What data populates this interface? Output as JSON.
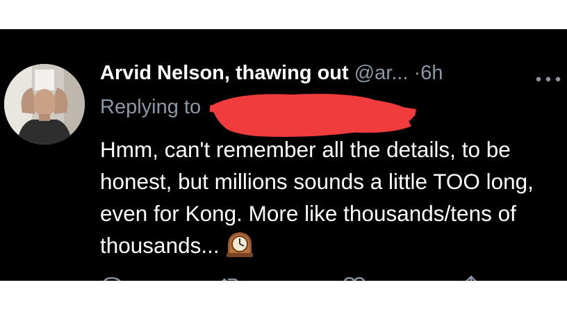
{
  "tweet": {
    "author_name": "Arvid Nelson, thawing out",
    "author_handle": "@ar...",
    "separator": "·",
    "time": "6h",
    "replying_label": "Replying to",
    "replying_to": "",
    "body": "Hmm, can't remember all the details, to be honest, but millions sounds a little TOO long, even for Kong. More like thousands/tens of thousands...",
    "emoji": "mantelpiece-clock"
  },
  "icons": {
    "more": "more-dots-icon",
    "reply": "reply-icon",
    "retweet": "retweet-icon",
    "like": "heart-icon",
    "share": "share-icon"
  },
  "colors": {
    "background": "#000000",
    "name": "#ffffff",
    "secondary": "#8b98a5",
    "body_text": "#ffffff",
    "redaction": "#f03c3c"
  }
}
